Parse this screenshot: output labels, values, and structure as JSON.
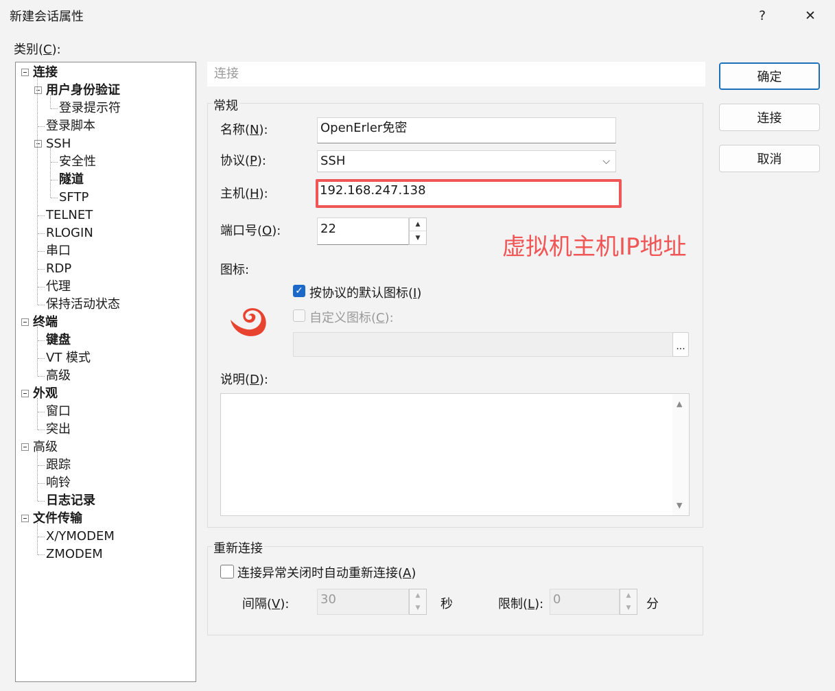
{
  "window": {
    "title": "新建会话属性",
    "help_glyph": "?",
    "close_glyph": "✕"
  },
  "category_label": {
    "text": "类别(",
    "key": "C",
    "suffix": "):"
  },
  "tree": [
    {
      "label": "连接",
      "bold": true,
      "level": 0,
      "toggle": true
    },
    {
      "label": "用户身份验证",
      "bold": true,
      "level": 1,
      "toggle": true
    },
    {
      "label": "登录提示符",
      "bold": false,
      "level": 2
    },
    {
      "label": "登录脚本",
      "bold": false,
      "level": 1
    },
    {
      "label": "SSH",
      "bold": false,
      "level": 1,
      "toggle": true
    },
    {
      "label": "安全性",
      "bold": false,
      "level": 2
    },
    {
      "label": "隧道",
      "bold": true,
      "level": 2
    },
    {
      "label": "SFTP",
      "bold": false,
      "level": 2
    },
    {
      "label": "TELNET",
      "bold": false,
      "level": 1
    },
    {
      "label": "RLOGIN",
      "bold": false,
      "level": 1
    },
    {
      "label": "串口",
      "bold": false,
      "level": 1
    },
    {
      "label": "RDP",
      "bold": false,
      "level": 1
    },
    {
      "label": "代理",
      "bold": false,
      "level": 1
    },
    {
      "label": "保持活动状态",
      "bold": false,
      "level": 1
    },
    {
      "label": "终端",
      "bold": true,
      "level": 0,
      "toggle": true
    },
    {
      "label": "键盘",
      "bold": true,
      "level": 1
    },
    {
      "label": "VT 模式",
      "bold": false,
      "level": 1
    },
    {
      "label": "高级",
      "bold": false,
      "level": 1
    },
    {
      "label": "外观",
      "bold": true,
      "level": 0,
      "toggle": true
    },
    {
      "label": "窗口",
      "bold": false,
      "level": 1
    },
    {
      "label": "突出",
      "bold": false,
      "level": 1
    },
    {
      "label": "高级",
      "bold": false,
      "level": 0,
      "toggle": true
    },
    {
      "label": "跟踪",
      "bold": false,
      "level": 1
    },
    {
      "label": "响铃",
      "bold": false,
      "level": 1
    },
    {
      "label": "日志记录",
      "bold": true,
      "level": 1
    },
    {
      "label": "文件传输",
      "bold": true,
      "level": 0,
      "toggle": true
    },
    {
      "label": "X/YMODEM",
      "bold": false,
      "level": 1
    },
    {
      "label": "ZMODEM",
      "bold": false,
      "level": 1
    }
  ],
  "section_title": "连接",
  "general": {
    "legend": "常规",
    "name_label": {
      "text": "名称(",
      "key": "N",
      "suffix": "):"
    },
    "name_value": "OpenErler免密",
    "protocol_label": {
      "text": "协议(",
      "key": "P",
      "suffix": "):"
    },
    "protocol_value": "SSH",
    "host_label": {
      "text": "主机(",
      "key": "H",
      "suffix": "):"
    },
    "host_value": "192.168.247.138",
    "port_label": {
      "text": "端口号(",
      "key": "O",
      "suffix": "):"
    },
    "port_value": "22",
    "icon_label": "图标:",
    "default_icon_cb": {
      "text": "按协议的默认图标(",
      "key": "I",
      "suffix": ")",
      "checked": true
    },
    "custom_icon_cb": {
      "text": "自定义图标(",
      "key": "C",
      "suffix": "):",
      "checked": false
    },
    "browse_label": "...",
    "desc_label": {
      "text": "说明(",
      "key": "D",
      "suffix": "):"
    }
  },
  "annotation": "虚拟机主机IP地址",
  "reconnect": {
    "legend": "重新连接",
    "auto_cb": {
      "text": "连接异常关闭时自动重新连接(",
      "key": "A",
      "suffix": ")",
      "checked": false
    },
    "interval_label": {
      "text": "间隔(",
      "key": "V",
      "suffix": "):"
    },
    "interval_value": "30",
    "interval_unit": "秒",
    "limit_label": {
      "text": "限制(",
      "key": "L",
      "suffix": "):"
    },
    "limit_value": "0",
    "limit_unit": "分"
  },
  "buttons": {
    "ok": "确定",
    "connect": "连接",
    "cancel": "取消"
  },
  "colors": {
    "accent": "#1b6ac9",
    "annotation": "#f05656",
    "icon": "#e8432f"
  }
}
